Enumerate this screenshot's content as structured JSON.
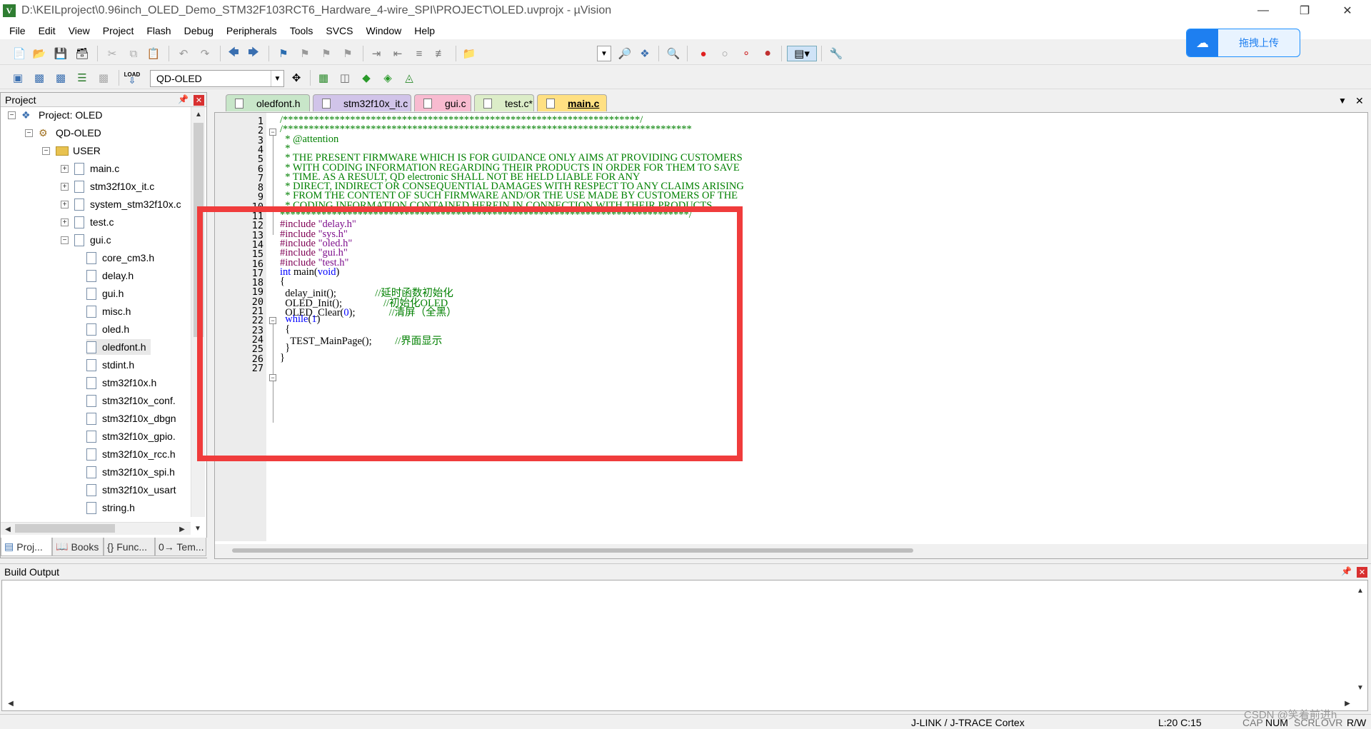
{
  "window": {
    "title": "D:\\KEILproject\\0.96inch_OLED_Demo_STM32F103RCT6_Hardware_4-wire_SPI\\PROJECT\\OLED.uvprojx - µVision",
    "app_icon": "V"
  },
  "menu": [
    "File",
    "Edit",
    "View",
    "Project",
    "Flash",
    "Debug",
    "Peripherals",
    "Tools",
    "SVCS",
    "Window",
    "Help"
  ],
  "upload_button": {
    "label": "拖拽上传",
    "icon": "cloud-icon",
    "color": "#1e7ff0"
  },
  "toolbar2": {
    "load_label": "LOAD",
    "target": "QD-OLED"
  },
  "project_panel": {
    "title": "Project",
    "tree": [
      {
        "label": "Project: OLED",
        "type": "project",
        "expander": "−"
      },
      {
        "label": "QD-OLED",
        "type": "target",
        "expander": "−"
      },
      {
        "label": "USER",
        "type": "folder",
        "expander": "−"
      },
      {
        "label": "main.c",
        "type": "file",
        "expander": "+"
      },
      {
        "label": "stm32f10x_it.c",
        "type": "file",
        "expander": "+"
      },
      {
        "label": "system_stm32f10x.c",
        "type": "file",
        "expander": "+"
      },
      {
        "label": "test.c",
        "type": "file",
        "expander": "+"
      },
      {
        "label": "gui.c",
        "type": "file",
        "expander": "−"
      },
      {
        "label": "core_cm3.h",
        "type": "header"
      },
      {
        "label": "delay.h",
        "type": "header"
      },
      {
        "label": "gui.h",
        "type": "header"
      },
      {
        "label": "misc.h",
        "type": "header"
      },
      {
        "label": "oled.h",
        "type": "header"
      },
      {
        "label": "oledfont.h",
        "type": "header",
        "selected": true
      },
      {
        "label": "stdint.h",
        "type": "header"
      },
      {
        "label": "stm32f10x.h",
        "type": "header"
      },
      {
        "label": "stm32f10x_conf.",
        "type": "header"
      },
      {
        "label": "stm32f10x_dbgn",
        "type": "header"
      },
      {
        "label": "stm32f10x_gpio.",
        "type": "header"
      },
      {
        "label": "stm32f10x_rcc.h",
        "type": "header"
      },
      {
        "label": "stm32f10x_spi.h",
        "type": "header"
      },
      {
        "label": "stm32f10x_usart",
        "type": "header"
      },
      {
        "label": "string.h",
        "type": "header"
      }
    ],
    "tabs": [
      "Proj...",
      "Books",
      "{} Func...",
      "0→ Tem..."
    ]
  },
  "editor_tabs": [
    {
      "label": "oledfont.h",
      "color": "#c8e6c9"
    },
    {
      "label": "stm32f10x_it.c",
      "color": "#d1c4e9"
    },
    {
      "label": "gui.c",
      "color": "#f8bbd0"
    },
    {
      "label": "test.c*",
      "color": "#dcedc8"
    },
    {
      "label": "main.c",
      "color": "#ffe082",
      "active": true
    }
  ],
  "editor_controls": {
    "dropdown": "▼",
    "close": "✕"
  },
  "code_lines": [
    {
      "n": "1",
      "parts": [
        [
          "cm",
          "/*********************************************************************/"
        ]
      ]
    },
    {
      "n": "2",
      "parts": [
        [
          "cm",
          "/*******************************************************************************"
        ]
      ]
    },
    {
      "n": "3",
      "parts": [
        [
          "cm",
          "  * @attention"
        ]
      ]
    },
    {
      "n": "4",
      "parts": [
        [
          "cm",
          "  *"
        ]
      ]
    },
    {
      "n": "5",
      "parts": [
        [
          "cm",
          "  * THE PRESENT FIRMWARE WHICH IS FOR GUIDANCE ONLY AIMS AT PROVIDING CUSTOMERS"
        ]
      ]
    },
    {
      "n": "6",
      "parts": [
        [
          "cm",
          "  * WITH CODING INFORMATION REGARDING THEIR PRODUCTS IN ORDER FOR THEM TO SAVE"
        ]
      ]
    },
    {
      "n": "7",
      "parts": [
        [
          "cm",
          "  * TIME. AS A RESULT, QD electronic SHALL NOT BE HELD LIABLE FOR ANY"
        ]
      ]
    },
    {
      "n": "8",
      "parts": [
        [
          "cm",
          "  * DIRECT, INDIRECT OR CONSEQUENTIAL DAMAGES WITH RESPECT TO ANY CLAIMS ARISING"
        ]
      ]
    },
    {
      "n": "9",
      "parts": [
        [
          "cm",
          "  * FROM THE CONTENT OF SUCH FIRMWARE AND/OR THE USE MADE BY CUSTOMERS OF THE"
        ]
      ]
    },
    {
      "n": "10",
      "parts": [
        [
          "cm",
          "  * CODING INFORMATION CONTAINED HEREIN IN CONNECTION WITH THEIR PRODUCTS."
        ]
      ]
    },
    {
      "n": "11",
      "parts": [
        [
          "cm",
          "*******************************************************************************/"
        ]
      ]
    },
    {
      "n": "12",
      "parts": [
        [
          "pp",
          "#include "
        ],
        [
          "st",
          "\"delay.h\""
        ]
      ]
    },
    {
      "n": "13",
      "parts": [
        [
          "pp",
          "#include "
        ],
        [
          "st",
          "\"sys.h\""
        ]
      ]
    },
    {
      "n": "14",
      "parts": [
        [
          "pp",
          "#include "
        ],
        [
          "st",
          "\"oled.h\""
        ]
      ]
    },
    {
      "n": "15",
      "parts": [
        [
          "pp",
          "#include "
        ],
        [
          "st",
          "\"gui.h\""
        ]
      ]
    },
    {
      "n": "16",
      "parts": [
        [
          "pp",
          "#include "
        ],
        [
          "st",
          "\"test.h\""
        ]
      ]
    },
    {
      "n": "17",
      "parts": [
        [
          "kw",
          "int"
        ],
        [
          "fn",
          " main("
        ],
        [
          "kw",
          "void"
        ],
        [
          "fn",
          ")"
        ]
      ]
    },
    {
      "n": "18",
      "parts": [
        [
          "fn",
          "{"
        ]
      ]
    },
    {
      "n": "19",
      "parts": [
        [
          "fn",
          "  delay_init();               "
        ],
        [
          "cm",
          "//延时函数初始化"
        ]
      ]
    },
    {
      "n": "20",
      "parts": [
        [
          "fn",
          "  OLED_Init();                "
        ],
        [
          "cm",
          "//初始化OLED"
        ]
      ]
    },
    {
      "n": "21",
      "parts": [
        [
          "fn",
          "  OLED_Clear("
        ],
        [
          "nm",
          "0"
        ],
        [
          "fn",
          ");             "
        ],
        [
          "cm",
          "//清屏（全黑）"
        ]
      ]
    },
    {
      "n": "22",
      "parts": [
        [
          "kw",
          "  while"
        ],
        [
          "fn",
          "("
        ],
        [
          "nm",
          "1"
        ],
        [
          "fn",
          ")"
        ]
      ]
    },
    {
      "n": "23",
      "parts": [
        [
          "fn",
          "  {"
        ]
      ]
    },
    {
      "n": "24",
      "parts": [
        [
          "fn",
          "    TEST_MainPage();         "
        ],
        [
          "cm",
          "//界面显示"
        ]
      ]
    },
    {
      "n": "25",
      "parts": [
        [
          "fn",
          "  }"
        ]
      ]
    },
    {
      "n": "26",
      "parts": [
        [
          "fn",
          "}"
        ]
      ]
    },
    {
      "n": "27",
      "parts": [
        [
          "fn",
          ""
        ]
      ]
    }
  ],
  "build_output": {
    "title": "Build Output"
  },
  "status_bar": {
    "debugger": "J-LINK / J-TRACE Cortex",
    "position": "L:20 C:15",
    "caps": "CAP",
    "num": "NUM",
    "scrl": "SCRL",
    "ovr": "OVR",
    "rw": "R/W"
  },
  "watermark": "CSDN @笑着前进h",
  "colors": {
    "highlight_box": "#f03c3c",
    "comment": "#008000",
    "keyword": "#0000ff"
  }
}
